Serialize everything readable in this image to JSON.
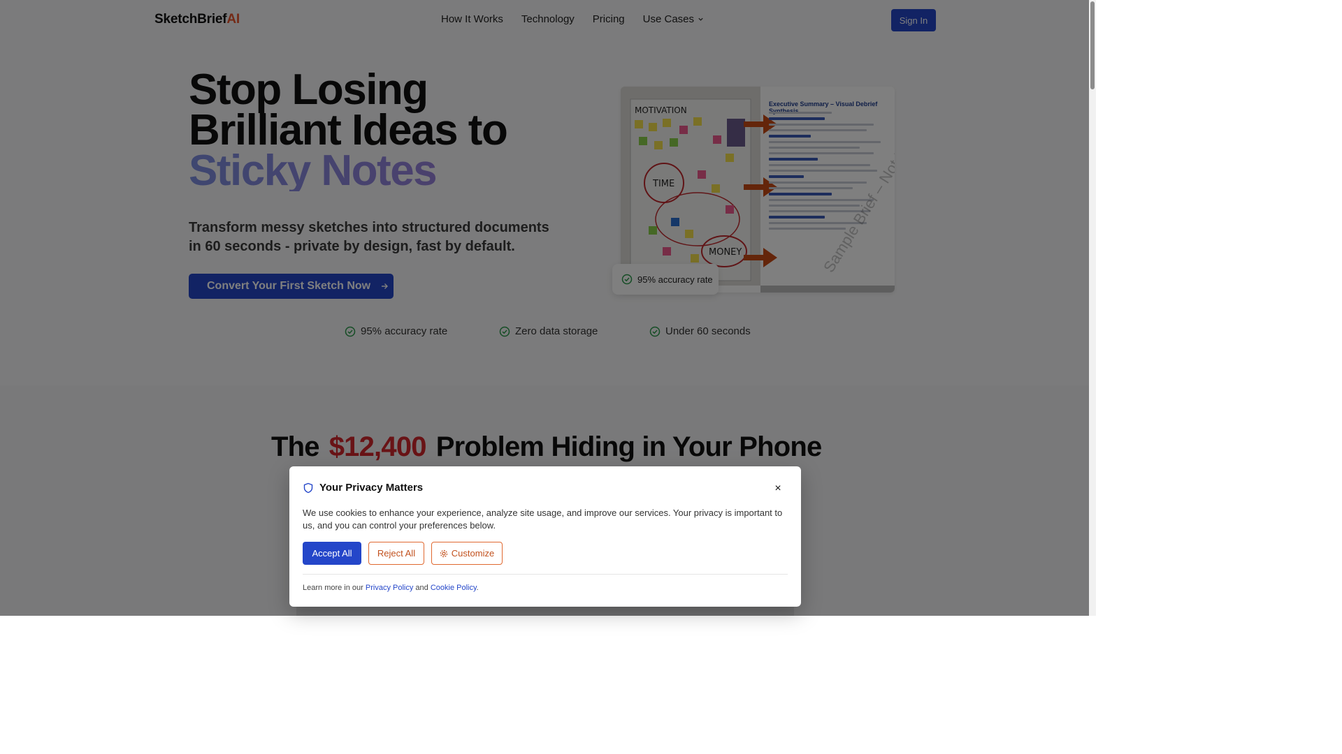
{
  "nav": {
    "logo_main": "SketchBrief",
    "logo_accent": "AI",
    "links": [
      "How It Works",
      "Technology",
      "Pricing",
      "Use Cases"
    ],
    "signin": "Sign In"
  },
  "hero": {
    "title_line1": "Stop Losing",
    "title_line2": "Brilliant Ideas to",
    "title_line3": "Sticky Notes",
    "subtitle": "Transform messy sketches into structured documents in 60 seconds - private by design, fast by default.",
    "cta": "Convert Your First Sketch Now",
    "features": [
      "95% accuracy rate",
      "Zero data storage",
      "Under 60 seconds"
    ],
    "image": {
      "doc_title": "Executive Summary – Visual Debrief Synthesis",
      "board_labels": [
        "MOTIVATION",
        "TIME",
        "MONEY"
      ],
      "watermark": "Sample Brief – Not Final"
    },
    "badge": "95% accuracy rate"
  },
  "problem": {
    "heading_prefix": "The",
    "amount": "$12,400",
    "heading_suffix": "Problem Hiding in Your Phone"
  },
  "cookie": {
    "title": "Your Privacy Matters",
    "text": "We use cookies to enhance your experience, analyze site usage, and improve our services. Your privacy is important to us, and you can control your preferences below.",
    "accept": "Accept All",
    "reject": "Reject All",
    "customize": "Customize",
    "footer_prefix": "Learn more in our",
    "privacy_link": "Privacy Policy",
    "footer_and": "and",
    "cookie_link": "Cookie Policy",
    "close": "×"
  },
  "colors": {
    "primary": "#2446c9",
    "accent": "#e8542c",
    "money": "#d3262c"
  }
}
